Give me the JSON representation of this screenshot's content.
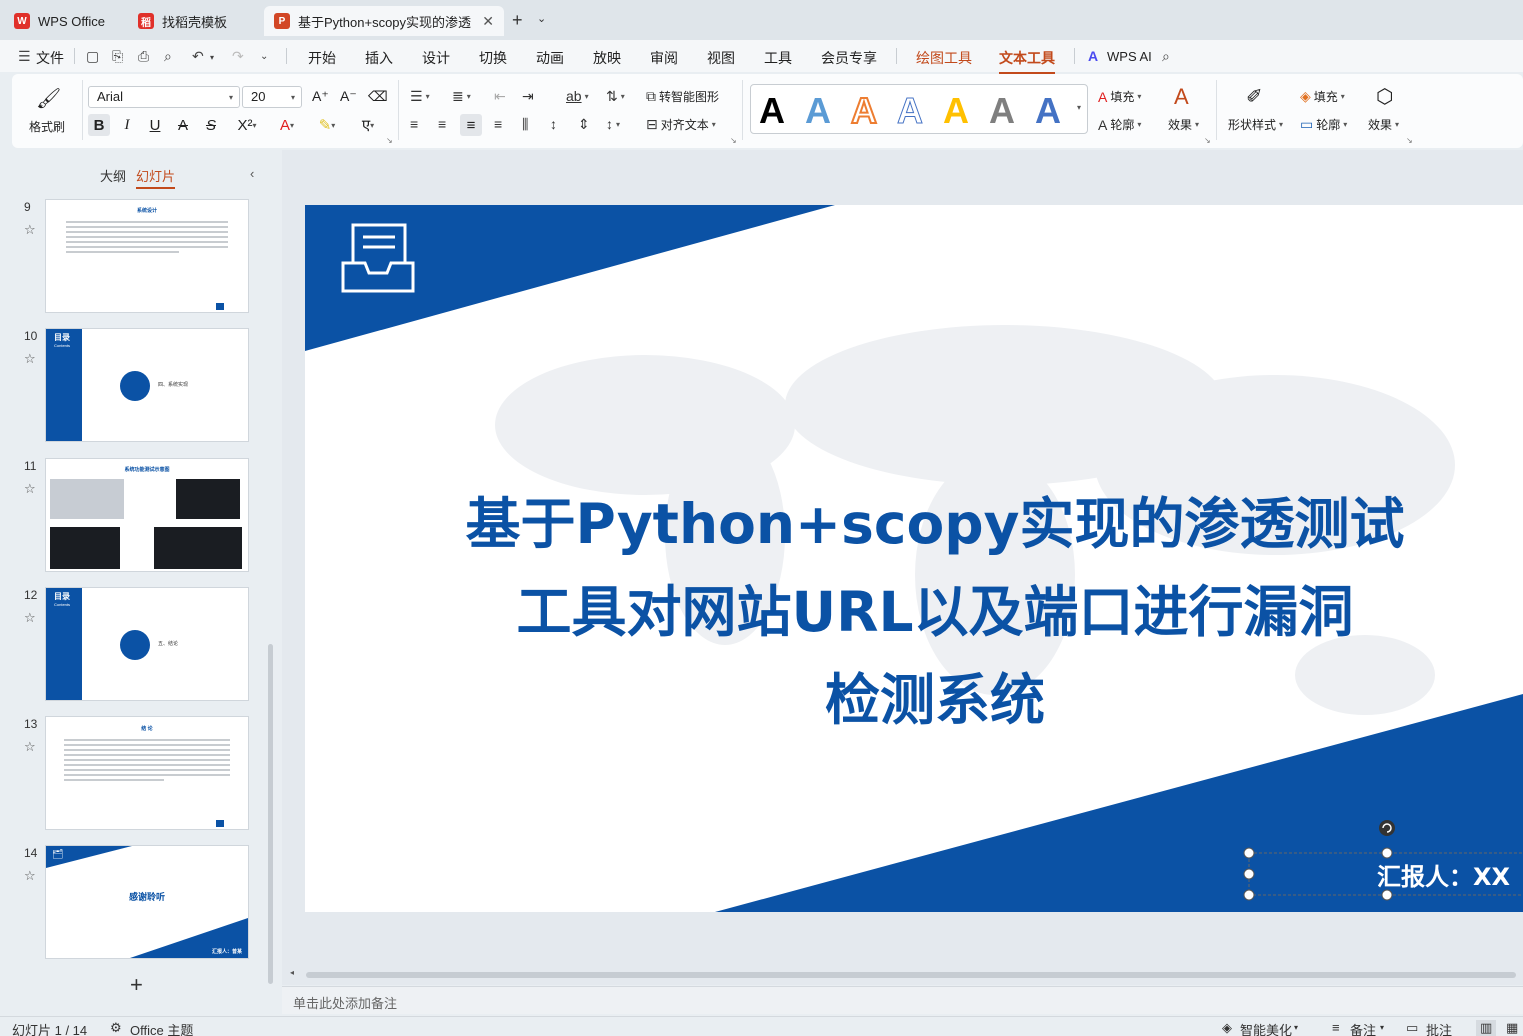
{
  "tabs": [
    {
      "label": "WPS Office",
      "icon": "wps-logo-icon",
      "color": "#e0302a"
    },
    {
      "label": "找稻壳模板",
      "icon": "docer-icon",
      "color": "#e0302a"
    },
    {
      "label": "基于Python+scopy实现的渗透",
      "icon": "ppt-file-icon",
      "color": "#d24726"
    }
  ],
  "menu": {
    "file": "文件",
    "items": [
      "开始",
      "插入",
      "设计",
      "切换",
      "动画",
      "放映",
      "审阅",
      "视图",
      "工具",
      "会员专享"
    ],
    "drawing_tools": "绘图工具",
    "text_tools": "文本工具",
    "wps_ai": "WPS AI"
  },
  "ribbon": {
    "format_painter": "格式刷",
    "font_name": "Arial",
    "font_size": "20",
    "convert_smartart": "转智能图形",
    "align_text": "对齐文本",
    "fill": "填充",
    "outline": "轮廓",
    "effects": "效果",
    "shape_style": "形状样式",
    "shape_fill": "填充",
    "shape_outline": "轮廓",
    "shape_effects": "效果"
  },
  "left_panel": {
    "tab_outline": "大纲",
    "tab_slides": "幻灯片",
    "thumbs": [
      {
        "num": "9",
        "title": "系统设计"
      },
      {
        "num": "10",
        "toc": "目录",
        "toc_en": "Contents",
        "label": "四、系统实现"
      },
      {
        "num": "11",
        "title": "系统功能测试示意图"
      },
      {
        "num": "12",
        "toc": "目录",
        "toc_en": "Contents",
        "label": "五、结论"
      },
      {
        "num": "13",
        "title": "结 论"
      },
      {
        "num": "14",
        "title": "感谢聆听",
        "footer": "汇报人：曾某"
      }
    ]
  },
  "slide": {
    "title_lines": [
      "基于Python+scopy实现的渗透测试",
      "工具对网站URL以及端口进行漏洞",
      "检测系统"
    ],
    "reporter": "汇报人：XX"
  },
  "notes_placeholder": "单击此处添加备注",
  "status": {
    "slide_count": "幻灯片 1 / 14",
    "theme": "Office 主题",
    "beautify": "智能美化",
    "notes": "备注",
    "comments": "批注"
  },
  "colors": {
    "brand_blue": "#0b52a5",
    "accent_orange": "#c24a1c"
  }
}
